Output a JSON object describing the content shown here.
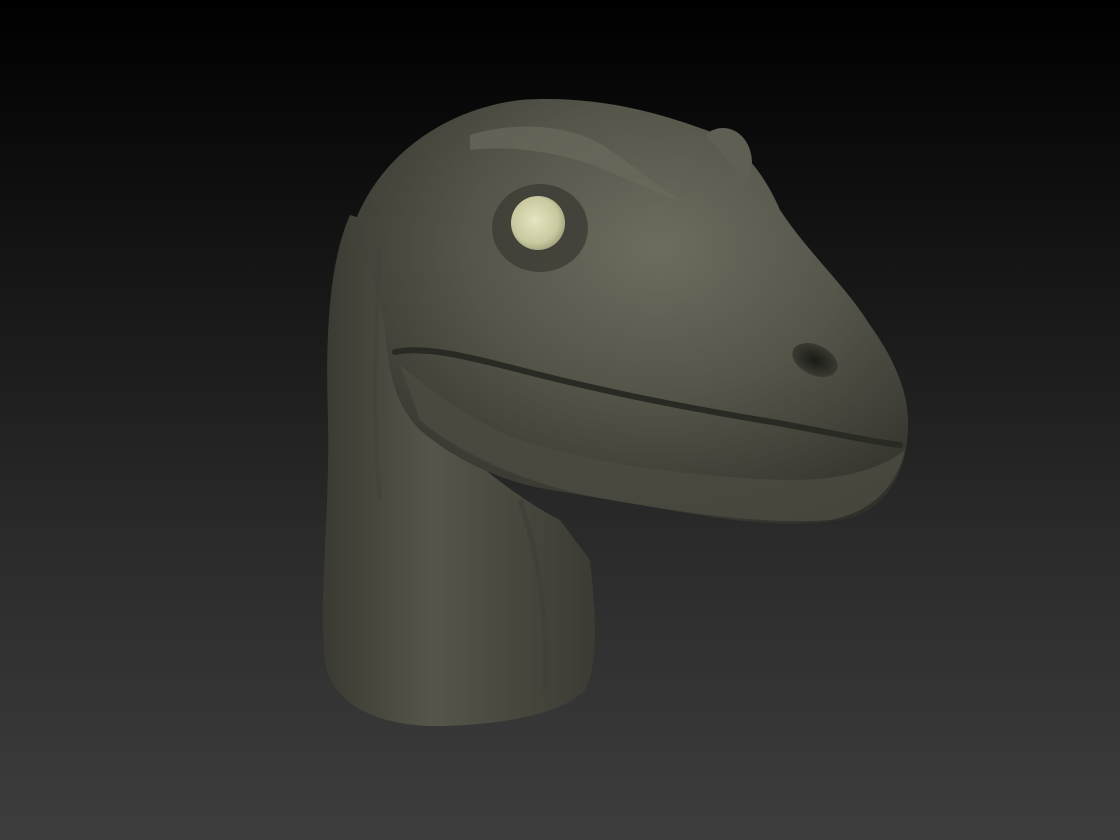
{
  "viewport": {
    "background_top": "#000000",
    "background_bottom": "#3d3d3d"
  },
  "model": {
    "subject": "raptor-head-sculpt",
    "skin_color": "#55554a",
    "skin_highlight": "#6c6c5f",
    "skin_shadow": "#2a2a24",
    "eye_color": "#c9caa0",
    "eye_highlight": "#e4e5c2"
  }
}
